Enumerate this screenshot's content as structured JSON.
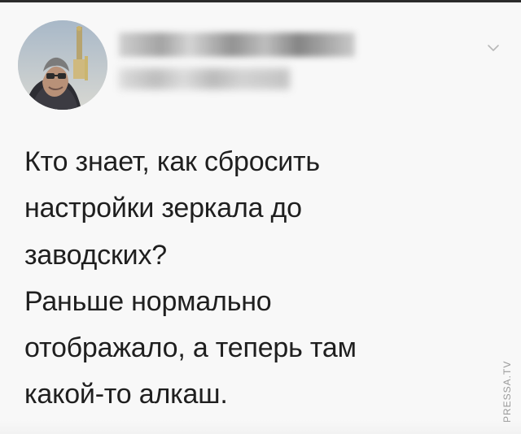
{
  "tweet": {
    "lines": [
      "Кто знает, как сбросить",
      "настройки зеркала до",
      "заводских?",
      "Раньше нормально",
      "отображало, а теперь там",
      "какой-то алкаш."
    ]
  },
  "header": {
    "icons": {
      "avatar": "avatar-photo",
      "menu": "chevron-down-icon"
    }
  },
  "watermark": {
    "text": "PRESSA.TV"
  },
  "colors": {
    "background": "#f8f8f8",
    "text": "#1f1f1f",
    "watermark": "#9a9a9a"
  }
}
